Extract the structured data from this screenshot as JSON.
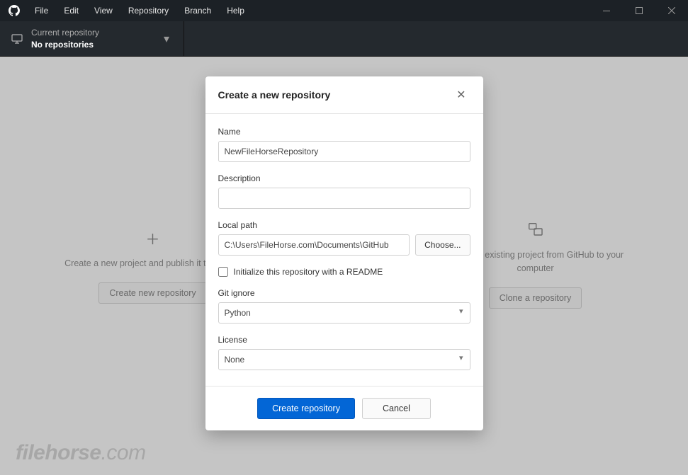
{
  "menu": {
    "file": "File",
    "edit": "Edit",
    "view": "View",
    "repository": "Repository",
    "branch": "Branch",
    "help": "Help"
  },
  "repoSwitch": {
    "label": "Current repository",
    "value": "No repositories"
  },
  "cards": {
    "create": {
      "desc": "Create a new project and publish it to GitHub",
      "btn": "Create new repository"
    },
    "clone": {
      "desc": "Clone an existing project from GitHub to your computer",
      "btn": "Clone a repository"
    }
  },
  "dialog": {
    "title": "Create a new repository",
    "name": {
      "label": "Name",
      "value": "NewFileHorseRepository"
    },
    "description": {
      "label": "Description",
      "value": ""
    },
    "localpath": {
      "label": "Local path",
      "value": "C:\\Users\\FileHorse.com\\Documents\\GitHub",
      "choose": "Choose..."
    },
    "readme": {
      "label": "Initialize this repository with a README",
      "checked": false
    },
    "gitignore": {
      "label": "Git ignore",
      "value": "Python"
    },
    "license": {
      "label": "License",
      "value": "None"
    },
    "submit": "Create repository",
    "cancel": "Cancel"
  },
  "watermark": {
    "a": "filehorse",
    "b": ".com"
  }
}
